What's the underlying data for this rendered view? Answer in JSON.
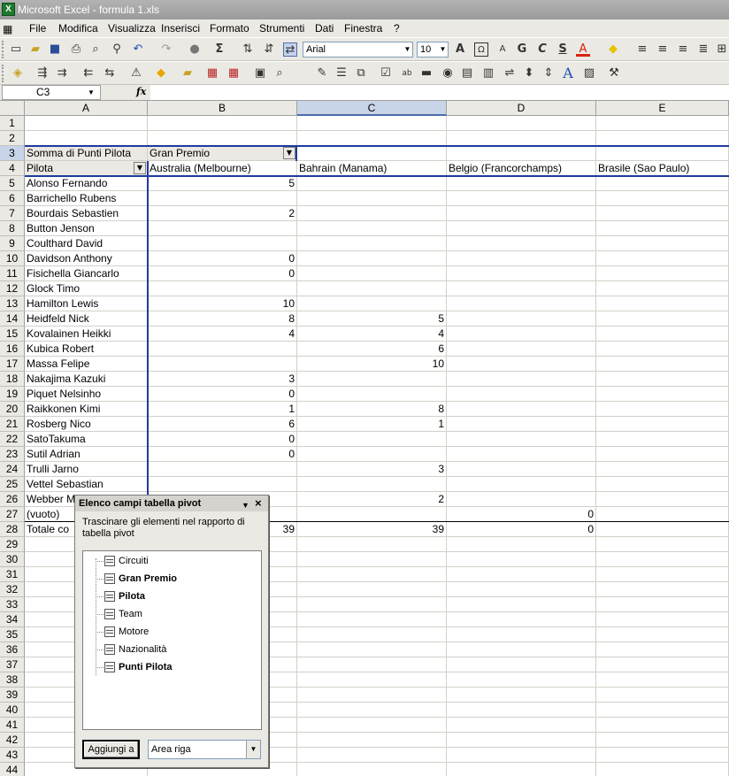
{
  "window": {
    "title": "Microsoft Excel - formula 1.xls"
  },
  "menu": [
    "File",
    "Modifica",
    "Visualizza",
    "Inserisci",
    "Formato",
    "Strumenti",
    "Dati",
    "Finestra",
    "?"
  ],
  "toolbar": {
    "font": "Arial",
    "size": "10"
  },
  "namebox": {
    "ref": "C3"
  },
  "formula_bar": {
    "fx": "fx",
    "value": ""
  },
  "columns": [
    "A",
    "B",
    "C",
    "D",
    "E"
  ],
  "selected_column": "C",
  "rows": [
    "1",
    "2",
    "3",
    "4",
    "5",
    "6",
    "7",
    "8",
    "9",
    "10",
    "11",
    "12",
    "13",
    "14",
    "15",
    "16",
    "17",
    "18",
    "19",
    "20",
    "21",
    "22",
    "23",
    "24",
    "25",
    "26",
    "27",
    "28",
    "29",
    "30",
    "31",
    "32",
    "33",
    "34",
    "35",
    "36",
    "37",
    "38",
    "39",
    "40",
    "41",
    "42",
    "43",
    "44"
  ],
  "pivot": {
    "data_field": "Somma di Punti Pilota",
    "column_field": "Gran Premio",
    "row_field": "Pilota",
    "column_items": [
      "Australia (Melbourne)",
      "Bahrain (Manama)",
      "Belgio (Francorchamps)",
      "Brasile (Sao Paulo)"
    ],
    "rows": [
      {
        "label": "Alonso Fernando",
        "b": "5",
        "c": "",
        "d": ""
      },
      {
        "label": "Barrichello Rubens",
        "b": "",
        "c": "",
        "d": ""
      },
      {
        "label": "Bourdais Sebastien",
        "b": "2",
        "c": "",
        "d": ""
      },
      {
        "label": "Button Jenson",
        "b": "",
        "c": "",
        "d": ""
      },
      {
        "label": "Coulthard David",
        "b": "",
        "c": "",
        "d": ""
      },
      {
        "label": "Davidson Anthony",
        "b": "0",
        "c": "",
        "d": ""
      },
      {
        "label": "Fisichella Giancarlo",
        "b": "0",
        "c": "",
        "d": ""
      },
      {
        "label": "Glock Timo",
        "b": "",
        "c": "",
        "d": ""
      },
      {
        "label": "Hamilton Lewis",
        "b": "10",
        "c": "",
        "d": ""
      },
      {
        "label": "Heidfeld Nick",
        "b": "8",
        "c": "5",
        "d": ""
      },
      {
        "label": "Kovalainen Heikki",
        "b": "4",
        "c": "4",
        "d": ""
      },
      {
        "label": "Kubica Robert",
        "b": "",
        "c": "6",
        "d": ""
      },
      {
        "label": "Massa Felipe",
        "b": "",
        "c": "10",
        "d": ""
      },
      {
        "label": "Nakajima Kazuki",
        "b": "3",
        "c": "",
        "d": ""
      },
      {
        "label": "Piquet Nelsinho",
        "b": "0",
        "c": "",
        "d": ""
      },
      {
        "label": "Raikkonen Kimi",
        "b": "1",
        "c": "8",
        "d": ""
      },
      {
        "label": "Rosberg Nico",
        "b": "6",
        "c": "1",
        "d": ""
      },
      {
        "label": "SatoTakuma",
        "b": "0",
        "c": "",
        "d": ""
      },
      {
        "label": "Sutil Adrian",
        "b": "0",
        "c": "",
        "d": ""
      },
      {
        "label": "Trulli Jarno",
        "b": "",
        "c": "3",
        "d": ""
      },
      {
        "label": "Vettel Sebastian",
        "b": "",
        "c": "",
        "d": ""
      },
      {
        "label": "Webber M",
        "b": "",
        "c": "2",
        "d": ""
      },
      {
        "label": "(vuoto)",
        "b": "",
        "c": "",
        "d": "0"
      },
      {
        "label": "Totale co",
        "b": "39",
        "c": "39",
        "d": "0"
      }
    ]
  },
  "panel": {
    "title": "Elenco campi tabella pivot",
    "description": "Trascinare gli elementi nel rapporto di tabella pivot",
    "fields": [
      {
        "name": "Circuiti",
        "bold": false
      },
      {
        "name": "Gran Premio",
        "bold": true
      },
      {
        "name": "Pilota",
        "bold": true
      },
      {
        "name": "Team",
        "bold": false
      },
      {
        "name": "Motore",
        "bold": false
      },
      {
        "name": "Nazionalità",
        "bold": false
      },
      {
        "name": "Punti Pilota",
        "bold": true
      }
    ],
    "add_button": "Aggiungi a",
    "area": "Area riga"
  }
}
